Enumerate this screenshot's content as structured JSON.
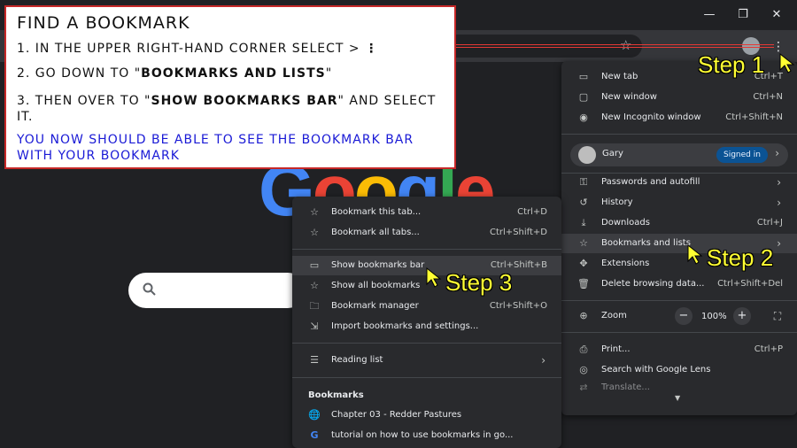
{
  "instructions": {
    "title": "Find a Bookmark",
    "step1": "1. In the upper right-hand corner select >",
    "step2_pre": "2. Go down to \"",
    "step2_bold": "Bookmarks and Lists",
    "step2_post": "\"",
    "step3_pre": "3. Then over to \"",
    "step3_bold": "Show Bookmarks Bar",
    "step3_post": "\" and select it.",
    "note": "You now should be able to see the bookmark bar with your bookmark"
  },
  "window": {
    "minimize": "—",
    "maximize": "❐",
    "close": "✕"
  },
  "callouts": {
    "step1": "Step 1",
    "step2": "Step 2",
    "step3": "Step 3"
  },
  "google_logo": [
    "G",
    "o",
    "o",
    "g",
    "l",
    "e"
  ],
  "main_menu": {
    "new_tab": {
      "label": "New tab",
      "shortcut": "Ctrl+T"
    },
    "new_window": {
      "label": "New window",
      "shortcut": "Ctrl+N"
    },
    "incognito": {
      "label": "New Incognito window",
      "shortcut": "Ctrl+Shift+N"
    },
    "profile": {
      "name": "Gary",
      "badge": "Signed in"
    },
    "passwords": {
      "label": "Passwords and autofill"
    },
    "history": {
      "label": "History"
    },
    "downloads": {
      "label": "Downloads",
      "shortcut": "Ctrl+J"
    },
    "bookmarks": {
      "label": "Bookmarks and lists"
    },
    "extensions": {
      "label": "Extensions"
    },
    "clear": {
      "label": "Delete browsing data...",
      "shortcut": "Ctrl+Shift+Del"
    },
    "zoom": {
      "label": "Zoom",
      "value": "100%",
      "minus": "−",
      "plus": "+"
    },
    "print": {
      "label": "Print...",
      "shortcut": "Ctrl+P"
    },
    "lens": {
      "label": "Search with Google Lens"
    },
    "translate": {
      "label": "Translate..."
    }
  },
  "sub_menu": {
    "bookmark_tab": {
      "label": "Bookmark this tab...",
      "shortcut": "Ctrl+D"
    },
    "bookmark_all": {
      "label": "Bookmark all tabs...",
      "shortcut": "Ctrl+Shift+D"
    },
    "show_bar": {
      "label": "Show bookmarks bar",
      "shortcut": "Ctrl+Shift+B"
    },
    "show_all": {
      "label": "Show all bookmarks"
    },
    "manager": {
      "label": "Bookmark manager",
      "shortcut": "Ctrl+Shift+O"
    },
    "import": {
      "label": "Import bookmarks and settings..."
    },
    "reading": {
      "label": "Reading list"
    },
    "section": "Bookmarks",
    "items": [
      {
        "label": "Chapter 03 - Redder Pastures"
      },
      {
        "label": "tutorial on how to use bookmarks in go..."
      }
    ]
  },
  "colors": {
    "google_blue": "#4285f4",
    "google_red": "#ea4335",
    "google_yellow": "#fbbc05",
    "google_green": "#34a853",
    "callout": "#ffff33",
    "note_text": "#1a1ad6"
  }
}
